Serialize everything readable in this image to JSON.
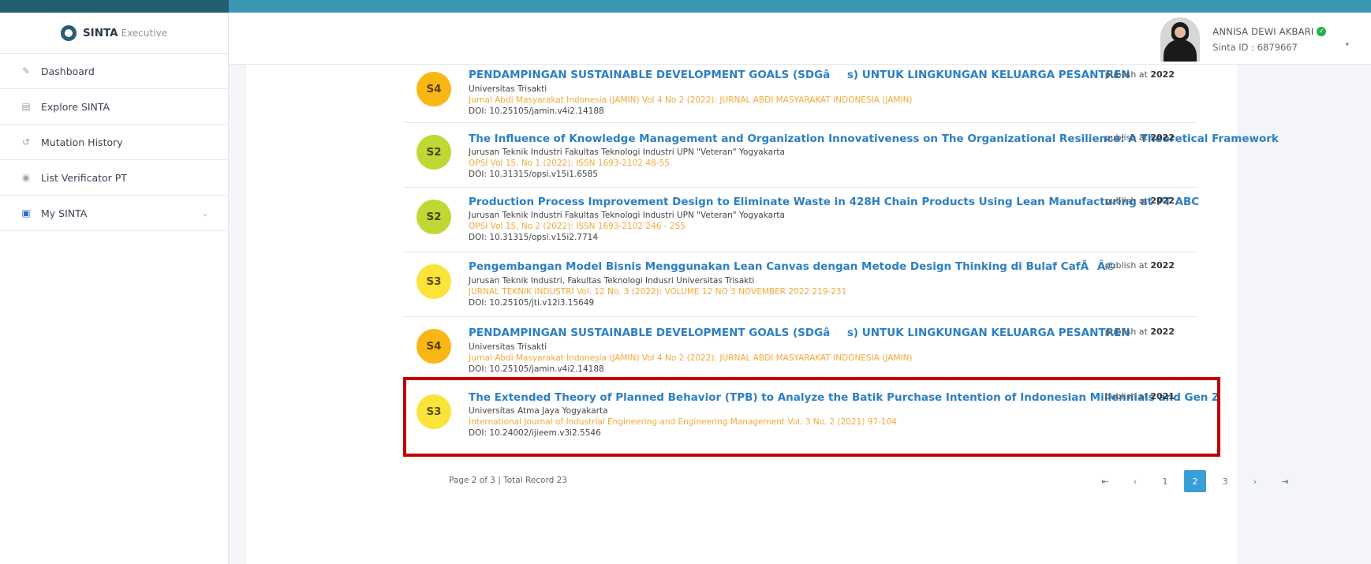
{
  "brand": {
    "name": "SINTA",
    "suffix": "Executive"
  },
  "user": {
    "name": "ANNISA DEWI AKBARI",
    "sinta_id": "Sinta ID : 6879667",
    "verified_glyph": "✓",
    "caret": "▾"
  },
  "sidebar": {
    "items": [
      {
        "label": "Dashboard",
        "icon": "pencil-icon",
        "glyph": "✎"
      },
      {
        "label": "Explore SINTA",
        "icon": "document-icon",
        "glyph": "▤"
      },
      {
        "label": "Mutation History",
        "icon": "history-icon",
        "glyph": "↺"
      },
      {
        "label": "List Verificator PT",
        "icon": "user-circle-icon",
        "glyph": "◉"
      },
      {
        "label": "My SINTA",
        "icon": "id-card-icon",
        "glyph": "▣",
        "caret": "⌄"
      }
    ]
  },
  "publications": [
    {
      "rank": "S4",
      "title": "PENDAMPINGAN SUSTAINABLE DEVELOPMENT GOALS (SDGâs) UNTUK LINGKUNGAN KELUARGA PESANTREN",
      "affiliation": "Universitas Trisakti",
      "venue": "Jurnal Abdi Masyarakat Indonesia (JAMIN) Vol 4 No 2 (2022): JURNAL ABDI MASYARAKAT INDONESIA (JAMIN)",
      "doi": "DOI: 10.25105/jamin.v4i2.14188",
      "publish_prefix": "publish at",
      "year": "2022"
    },
    {
      "rank": "S2",
      "title": "The Influence of Knowledge Management and Organization Innovativeness on The Organizational Resilience: A Theoretical Framework",
      "affiliation": "Jurusan Teknik Industri Fakultas Teknologi Industri UPN \"Veteran\" Yogyakarta",
      "venue": "OPSI Vol 15, No 1 (2022): ISSN 1693-2102 48-55",
      "doi": "DOI: 10.31315/opsi.v15i1.6585",
      "publish_prefix": "publish at",
      "year": "2022"
    },
    {
      "rank": "S2",
      "title": "Production Process Improvement Design to Eliminate Waste in 428H Chain Products Using Lean Manufacturing at PT ABC",
      "affiliation": "Jurusan Teknik Industri Fakultas Teknologi Industri UPN \"Veteran\" Yogyakarta",
      "venue": "OPSI Vol 15, No 2 (2022): ISSN 1693-2102 246 - 255",
      "doi": "DOI: 10.31315/opsi.v15i2.7714",
      "publish_prefix": "publish at",
      "year": "2022"
    },
    {
      "rank": "S3",
      "title": "Pengembangan Model Bisnis Menggunakan Lean Canvas dengan Metode Design Thinking di Bulaf CafÃÂ©",
      "affiliation": "Jurusan Teknik Industri, Fakultas Teknologi Indusri Universitas Trisakti",
      "venue": "JURNAL TEKNIK INDUSTRI Vol. 12 No. 3 (2022): VOLUME 12 NO 3 NOVEMBER 2022 219-231",
      "doi": "DOI: 10.25105/jti.v12i3.15649",
      "publish_prefix": "publish at",
      "year": "2022"
    },
    {
      "rank": "S4",
      "title": "PENDAMPINGAN SUSTAINABLE DEVELOPMENT GOALS (SDGâs) UNTUK LINGKUNGAN KELUARGA PESANTREN",
      "affiliation": "Universitas Trisakti",
      "venue": "Jurnal Abdi Masyarakat Indonesia (JAMIN) Vol 4 No 2 (2022): JURNAL ABDI MASYARAKAT INDONESIA (JAMIN)",
      "doi": "DOI: 10.25105/jamin.v4i2.14188",
      "publish_prefix": "publish at",
      "year": "2022"
    },
    {
      "rank": "S3",
      "title": "The Extended Theory of Planned Behavior (TPB) to Analyze the Batik Purchase Intention of Indonesian Millennials and Gen Z",
      "affiliation": "Universitas Atma Jaya Yogyakarta",
      "venue": "International Journal of Industrial Engineering and Engineering Management Vol. 3 No. 2 (2021) 97-104",
      "doi": "DOI: 10.24002/ijieem.v3i2.5546",
      "publish_prefix": "publish at",
      "year": "2021"
    }
  ],
  "footer": {
    "page_info": "Page 2 of 3 | Total Record 23"
  },
  "pagination": {
    "first": "⇤",
    "prev": "‹",
    "pages": [
      "1",
      "2",
      "3"
    ],
    "current": "2",
    "next": "›",
    "last": "⇥"
  }
}
